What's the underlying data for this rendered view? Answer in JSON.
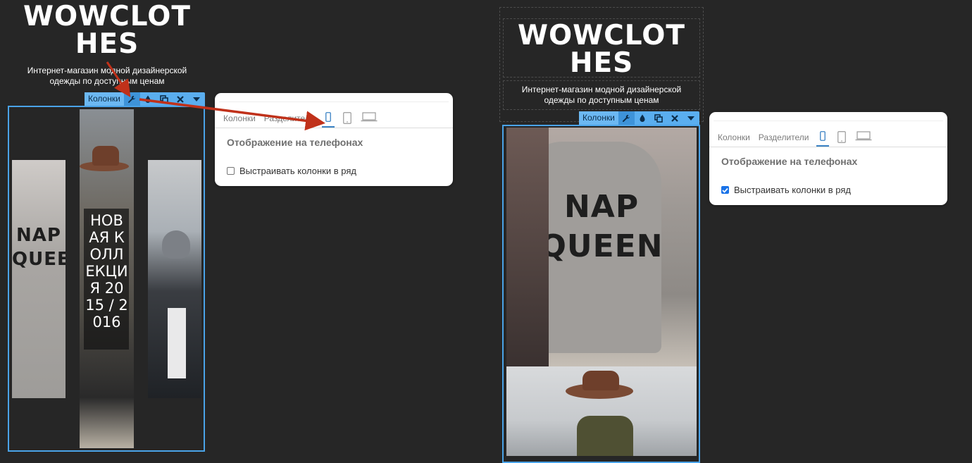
{
  "brand": "WOWCLOTHES",
  "tagline": "Интернет-магазин модной дизайнерской одежды по доступным ценам",
  "toolbar": {
    "label": "Колонки",
    "icons": [
      "wrench-icon",
      "drop-icon",
      "copy-icon",
      "close-icon",
      "chevron-down-icon"
    ]
  },
  "panel": {
    "tab_columns": "Колонки",
    "tab_dividers": "Разделители",
    "device_tabs": [
      "phone-icon",
      "tablet-icon",
      "laptop-icon"
    ],
    "heading": "Отображение на телефонах",
    "option_label": "Выстраивать колонки в ряд"
  },
  "left": {
    "option_checked": false
  },
  "right": {
    "option_checked": true
  },
  "collection_caption": "НОВАЯ КОЛЛЕКЦИЯ 2015 / 2016",
  "sweater_text": {
    "line1": "NAP",
    "line2": "QUEEN"
  },
  "colors": {
    "background": "#262626",
    "accent": "#5aaeef",
    "arrow": "#c0311a",
    "checkbox": "#1a73e8"
  }
}
